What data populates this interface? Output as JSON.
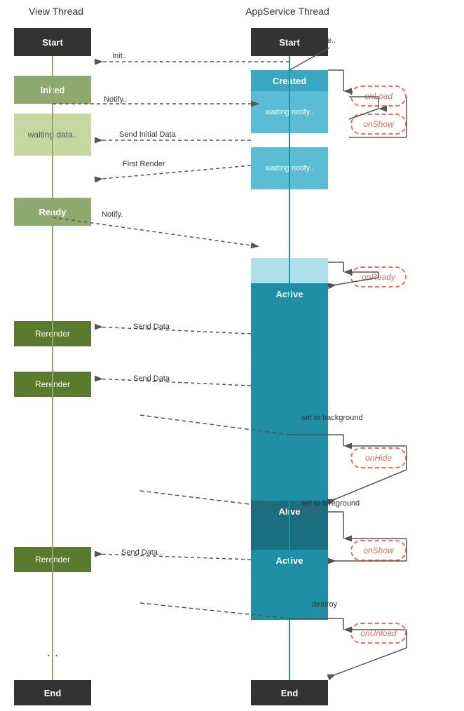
{
  "headers": {
    "view_thread": "View Thread",
    "app_thread": "AppService Thread"
  },
  "view_states": {
    "start": "Start",
    "inited": "Inited",
    "waiting_data": "waiting data..",
    "ready": "Ready",
    "rerender1": "Rerender",
    "rerender2": "Rerender",
    "rerender3": "Rerender",
    "dots": "...",
    "end": "End"
  },
  "app_states": {
    "start": "Start",
    "created": "Created",
    "waiting_notify1": "waiting notify..",
    "waiting_notify2": "waiting notify..",
    "active1": "Active",
    "alive": "Alive",
    "active2": "Active",
    "end": "End"
  },
  "callbacks": {
    "onload": "onLoad",
    "onshow1": "onShow",
    "onready": "onReady",
    "onhide": "onHide",
    "onshow2": "onShow",
    "onunload": "onUnload"
  },
  "arrow_labels": {
    "init": "Init..",
    "create": "Create..",
    "notify1": "Notify..",
    "send_initial_data": "Send Initial Data",
    "first_render": "First Render",
    "notify2": "Notify.",
    "send_data1": "Send Data",
    "send_data2": "Send Data",
    "set_to_background": "set to background",
    "set_to_foreground": "set to foreground",
    "send_data3": "Send Data...",
    "destroy": "destroy"
  },
  "colors": {
    "dark": "#333333",
    "green_dark": "#5a7a2e",
    "green_mid": "#8faa6e",
    "green_light": "#c5d8a0",
    "teal_dark": "#1a6e7e",
    "teal_mid": "#1e8fa5",
    "teal_light": "#5bbdd4",
    "teal_lighter": "#aee0ec",
    "callback_border": "#e87060",
    "callback_text": "#e87060"
  }
}
